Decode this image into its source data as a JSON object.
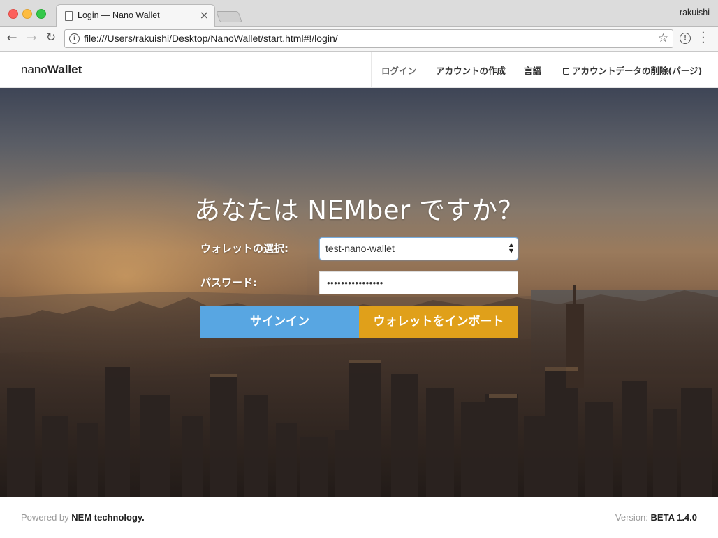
{
  "browser": {
    "tab_title": "Login — Nano Wallet",
    "tab_close": "×",
    "profile_name": "rakuishi",
    "url": "file:///Users/rakuishi/Desktop/NanoWallet/start.html#!/login/",
    "nav": {
      "back": "←",
      "forward": "→",
      "reload": "↻",
      "star": "☆"
    }
  },
  "app": {
    "logo": {
      "light": "nano",
      "bold": "Wallet"
    },
    "nav": {
      "login": "ログイン",
      "create_account": "アカウントの作成",
      "language": "言語",
      "purge": "アカウントデータの削除(パージ)"
    }
  },
  "login": {
    "heading": "あなたは NEMber ですか？",
    "wallet_label": "ウォレットの選択:",
    "wallet_selected": "test-nano-wallet",
    "password_label": "パスワード:",
    "password_value": "••••••••••••••••",
    "signin_button": "サインイン",
    "import_button": "ウォレットをインポート"
  },
  "footer": {
    "powered_prefix": "Powered by",
    "powered_brand": "NEM technology.",
    "version_label": "Version:",
    "version_value": "BETA 1.4.0"
  },
  "colors": {
    "signin": "#58a6e2",
    "import": "#e0a01a"
  }
}
